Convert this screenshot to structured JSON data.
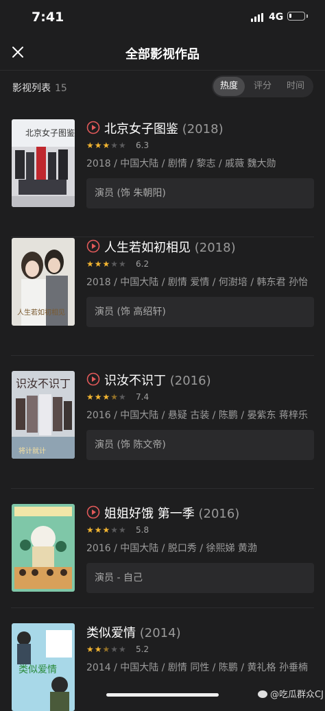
{
  "status": {
    "time": "7:41",
    "network": "4G"
  },
  "header": {
    "title": "全部影视作品"
  },
  "list": {
    "label": "影视列表",
    "count": "15"
  },
  "sort_options": [
    "热度",
    "评分",
    "时间"
  ],
  "items": [
    {
      "title": "北京女子图鉴",
      "year": "(2018)",
      "score": "6.3",
      "stars_on": 3,
      "meta": "2018 / 中国大陆 / 剧情 / 黎志 / 戚薇 魏大勋",
      "role": "演员 (饰 朱朝阳)",
      "has_play": true
    },
    {
      "title": "人生若如初相见",
      "year": "(2018)",
      "score": "6.2",
      "stars_on": 3,
      "meta": "2018 / 中国大陆 / 剧情 爱情 / 何澍培 / 韩东君 孙怡",
      "role": "演员 (饰 高绍轩)",
      "has_play": true
    },
    {
      "title": "识汝不识丁",
      "year": "(2016)",
      "score": "7.4",
      "stars_on": 3.5,
      "meta": "2016 / 中国大陆 / 悬疑 古装 / 陈鹏 / 晏紫东 蒋梓乐",
      "role": "演员 (饰 陈文帝)",
      "has_play": true
    },
    {
      "title": "姐姐好饿 第一季",
      "year": "(2016)",
      "score": "5.8",
      "stars_on": 3,
      "meta": "2016 / 中国大陆 / 脱口秀 / 徐熙娣 黄渤",
      "role": "演员 - 自己",
      "has_play": true
    },
    {
      "title": "类似爱情",
      "year": "(2014)",
      "score": "5.2",
      "stars_on": 2.5,
      "meta": "2014 / 中国大陆 / 剧情 同性 / 陈鹏 / 黄礼格 孙垂楠",
      "role": "",
      "has_play": false
    }
  ],
  "watermark": "@吃瓜群众CJ",
  "colors": {
    "background": "#1e1e1f",
    "star": "#f3b531",
    "play": "#e35a5a"
  }
}
